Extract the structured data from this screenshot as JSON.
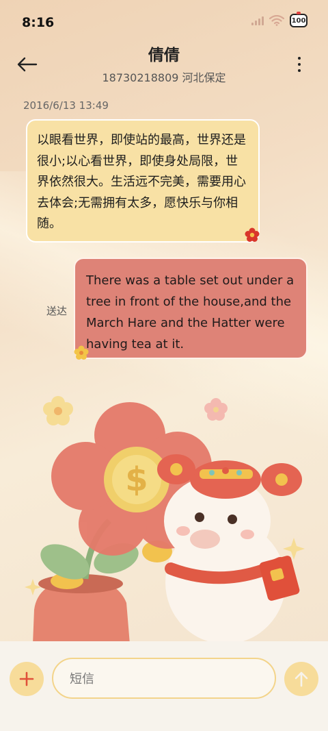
{
  "status_bar": {
    "time": "8:16",
    "battery": "100",
    "icons": [
      "signal-icon",
      "wifi-icon",
      "battery-icon"
    ]
  },
  "header": {
    "back_icon": "arrow-left-icon",
    "contact_name": "倩倩",
    "contact_detail": "18730218809 河北保定",
    "more_icon": "more-vertical-icon"
  },
  "conversation": {
    "timestamp": "2016/6/13 13:49",
    "messages": [
      {
        "direction": "incoming",
        "text": "以眼看世界，即使站的最高，世界还是很小;以心看世界，即使身处局限，世界依然很大。生活远不完美，需要用心去体会;无需拥有太多，愿快乐与你相随。"
      },
      {
        "direction": "outgoing",
        "text": "There was a table set out under a tree in front of the house,and the March Hare and the Hatter were having tea at it.",
        "status": "送达"
      }
    ]
  },
  "composer": {
    "add_icon": "plus-icon",
    "placeholder": "短信",
    "send_icon": "arrow-up-icon"
  },
  "colors": {
    "incoming_bubble": "#f8e1a5",
    "outgoing_bubble": "#de8377",
    "accent": "#f7dc9a",
    "icon_red": "#e0503a"
  }
}
